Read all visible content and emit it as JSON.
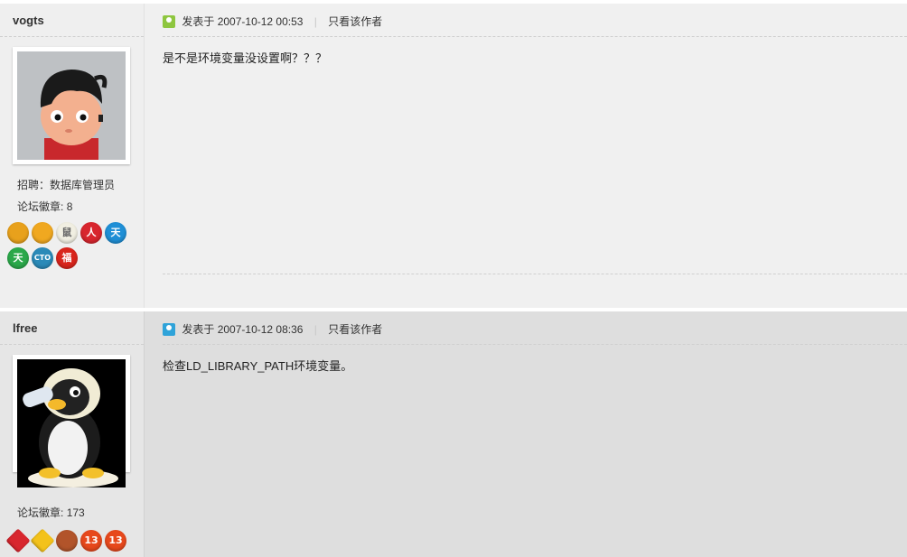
{
  "posts": [
    {
      "author": "vogts",
      "posted_prefix": "发表于",
      "posted_at": "2007-10-12 00:53",
      "only_author_label": "只看该作者",
      "body": "是不是环境变量没设置啊？？？",
      "job": "招聘：数据库管理员",
      "badges_label": "论坛徽章:",
      "badges_count": "8",
      "icon_color": "#8ec63f",
      "medals": [
        {
          "name": "medal-gold-2007-icon",
          "text": "",
          "color": "#e8a11c"
        },
        {
          "name": "medal-gold-2008-icon",
          "text": "",
          "color": "#f0a820"
        },
        {
          "name": "medal-rat-icon",
          "text": "鼠",
          "color": "#f1efe2"
        },
        {
          "name": "medal-red-icon",
          "text": "人",
          "color": "#d8262e"
        },
        {
          "name": "medal-blue-day-icon",
          "text": "天",
          "color": "#1f8fd6"
        },
        {
          "name": "medal-green-icon",
          "text": "天",
          "color": "#2ba84a"
        },
        {
          "name": "medal-cto-icon",
          "text": "CTO",
          "color": "#2b8ab8"
        },
        {
          "name": "medal-fu-icon",
          "text": "福",
          "color": "#d9251c"
        }
      ]
    },
    {
      "author": "lfree",
      "posted_prefix": "发表于",
      "posted_at": "2007-10-12 08:36",
      "only_author_label": "只看该作者",
      "body": "检查LD_LIBRARY_PATH环境变量。",
      "badges_label": "论坛徽章:",
      "badges_count": "173",
      "icon_color": "#2fa3d9",
      "medals": [
        {
          "name": "medal-red-diamond-icon",
          "text": "",
          "color": "#d8262e"
        },
        {
          "name": "medal-yellow-diamond-icon",
          "text": "",
          "color": "#f3c21b"
        },
        {
          "name": "medal-bowl-icon",
          "text": "",
          "color": "#b2542a"
        },
        {
          "name": "medal-13-icon",
          "text": "13",
          "color": "#e7481c"
        },
        {
          "name": "medal-13b-icon",
          "text": "13",
          "color": "#e7481c"
        }
      ]
    }
  ]
}
